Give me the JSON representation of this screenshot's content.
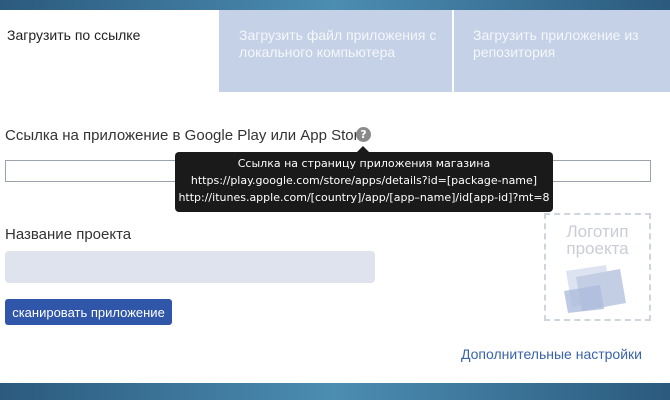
{
  "tabs": [
    {
      "label": "Загрузить по ссылке"
    },
    {
      "label": "Загрузить файл приложения с локального компьютера"
    },
    {
      "label": "Загрузить приложение из репозитория"
    }
  ],
  "form": {
    "url_label": "Ссылка на приложение в Google Play или App Store",
    "help_icon": "?",
    "url_value": "",
    "project_name_label": "Название проекта",
    "project_name_value": "",
    "scan_button": "сканировать приложение",
    "logo_placeholder": "Логотип проекта",
    "more_settings": "Дополнительные настройки"
  },
  "tooltip": {
    "lines": [
      "Ссылка на страницу приложения магазина",
      "https://play.google.com/store/apps/details?id=[package-name]",
      "http://itunes.apple.com/[country]/app/[app–name]/id[app-id]?mt=8"
    ]
  },
  "colors": {
    "accent": "#2f56a8",
    "tab_inactive": "#c5d1e6",
    "tooltip_bg": "#1a1a1a",
    "link": "#3a63a8"
  }
}
